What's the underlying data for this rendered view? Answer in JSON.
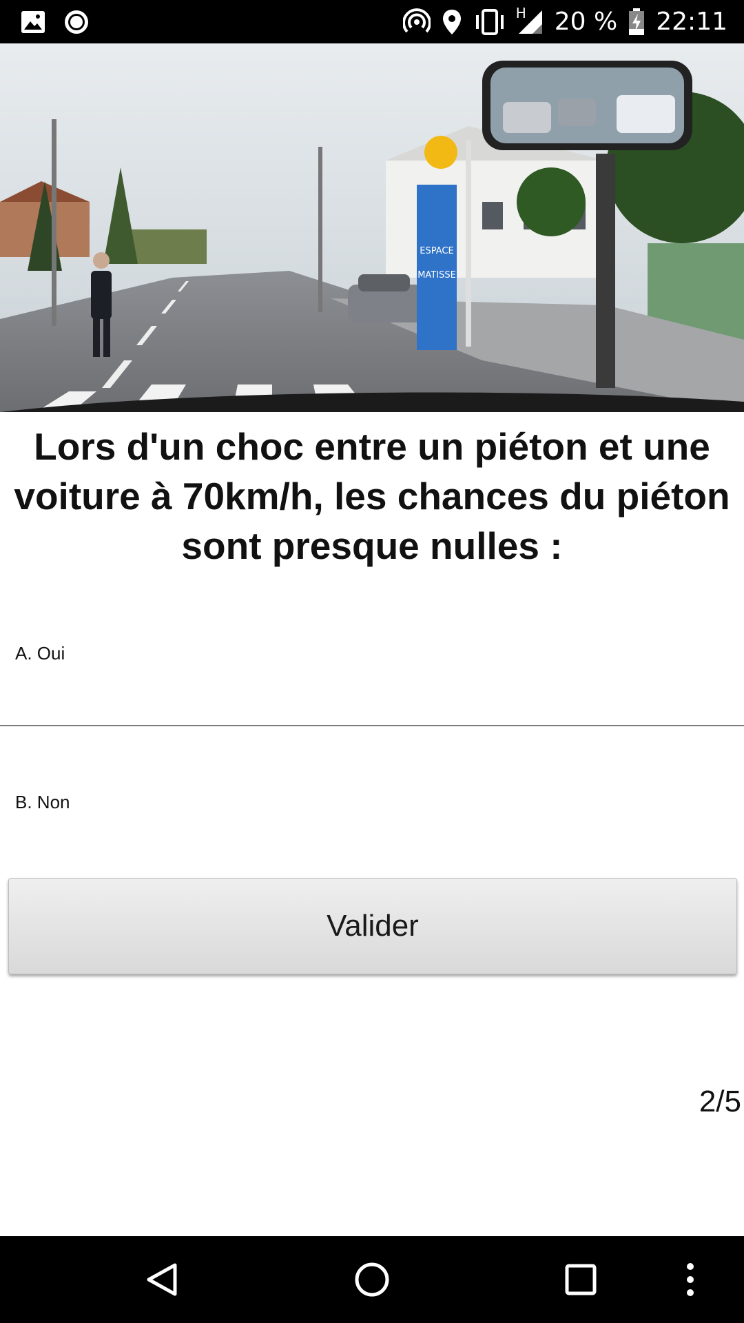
{
  "status_bar": {
    "battery": "20 %",
    "network_type": "H",
    "time": "22:11",
    "icons": [
      "image-icon",
      "record-icon",
      "hotspot-icon",
      "location-icon",
      "vibrate-icon",
      "signal-icon",
      "battery-icon"
    ]
  },
  "hero": {
    "sign_lines": [
      "ESPACE",
      "MATISSE"
    ]
  },
  "question": {
    "text": "Lors d'un choc entre un piéton et une voiture à 70km/h, les chances du piéton sont presque nulles :"
  },
  "answers": [
    {
      "label": "A. Oui"
    },
    {
      "label": "B. Non"
    }
  ],
  "validate_label": "Valider",
  "counter": "2/5",
  "nav_bar": {
    "icons": [
      "back-icon",
      "home-icon",
      "recents-icon",
      "more-icon"
    ]
  }
}
